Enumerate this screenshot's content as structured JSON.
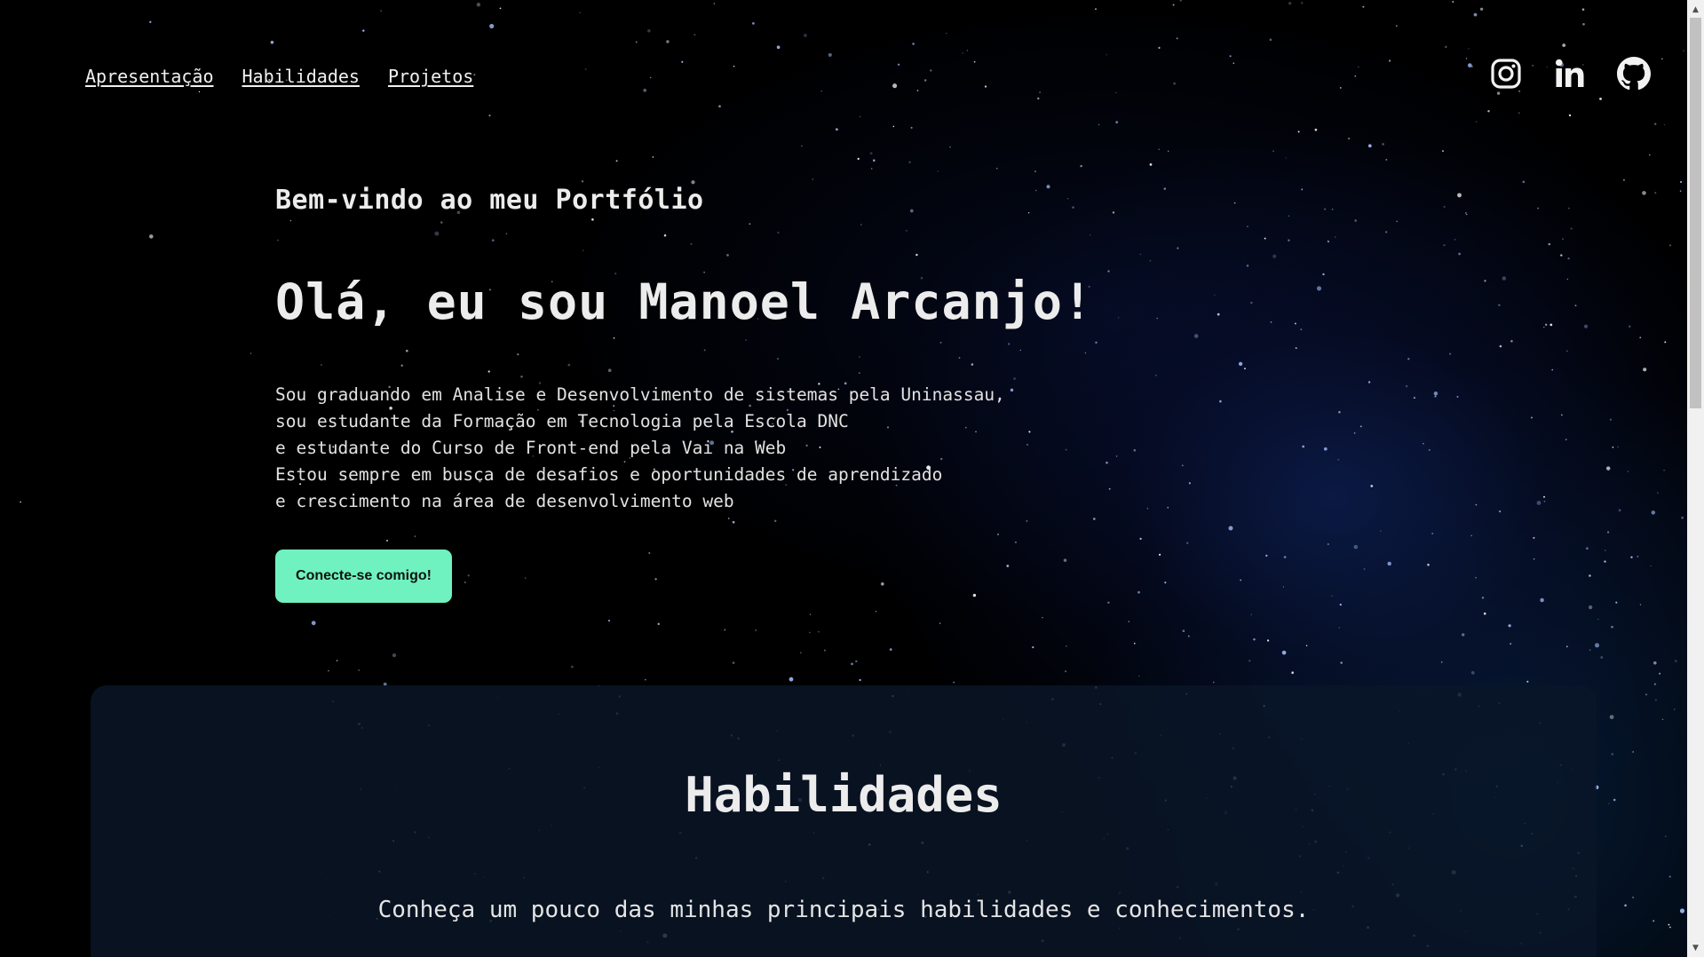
{
  "nav": {
    "items": [
      {
        "label": "Apresentação"
      },
      {
        "label": "Habilidades"
      },
      {
        "label": "Projetos"
      }
    ]
  },
  "socials": [
    {
      "icon": "instagram-icon"
    },
    {
      "icon": "linkedin-icon"
    },
    {
      "icon": "github-icon"
    }
  ],
  "hero": {
    "welcome": "Bem-vindo ao meu Portfólio",
    "headline": "Olá, eu sou Manoel Arcanjo!",
    "bio_lines": [
      "Sou graduando em Analise e Desenvolvimento de sistemas pela Uninassau,",
      "sou estudante da Formação em Tecnologia pela Escola DNC",
      "e estudante do Curso de Front-end pela Vai na Web",
      "Estou sempre em busca de desafios e oportunidades de aprendizado",
      "e crescimento na área de desenvolvimento web"
    ],
    "cta_label": "Conecte-se comigo!"
  },
  "skills": {
    "title": "Habilidades",
    "subtitle": "Conheça um pouco das minhas principais habilidades e conhecimentos."
  },
  "colors": {
    "accent": "#6ff2bf",
    "background": "#000000",
    "card": "#0a1628",
    "text": "#ececec"
  }
}
